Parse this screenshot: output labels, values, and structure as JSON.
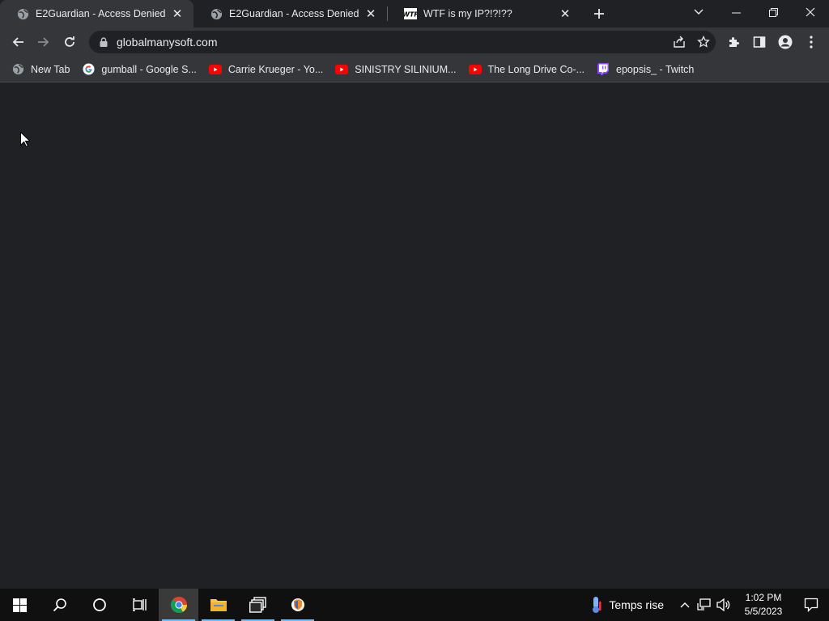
{
  "tabs": [
    {
      "title": "E2Guardian - Access Denied",
      "active": true,
      "favicon": "globe-icon"
    },
    {
      "title": "E2Guardian - Access Denied",
      "active": false,
      "favicon": "globe-icon"
    },
    {
      "title": "WTF is my IP?!?!??",
      "active": false,
      "favicon": "wtf-icon"
    }
  ],
  "omnibox": {
    "url": "globalmanysoft.com"
  },
  "bookmarks": [
    {
      "label": "New Tab",
      "icon": "globe-icon"
    },
    {
      "label": "gumball - Google S...",
      "icon": "google-icon"
    },
    {
      "label": "Carrie Krueger - Yo...",
      "icon": "youtube-icon"
    },
    {
      "label": "SINISTRY SILINIUM...",
      "icon": "youtube-icon"
    },
    {
      "label": "The Long Drive Co-...",
      "icon": "youtube-icon"
    },
    {
      "label": "epopsis_ - Twitch",
      "icon": "twitch-icon"
    }
  ],
  "tray": {
    "weather": "Temps rise",
    "time": "1:02 PM",
    "date": "5/5/2023"
  },
  "colors": {
    "background": "#202124",
    "toolbar": "#35363a",
    "taskbar": "#101010",
    "accent": "#76b9ed"
  }
}
